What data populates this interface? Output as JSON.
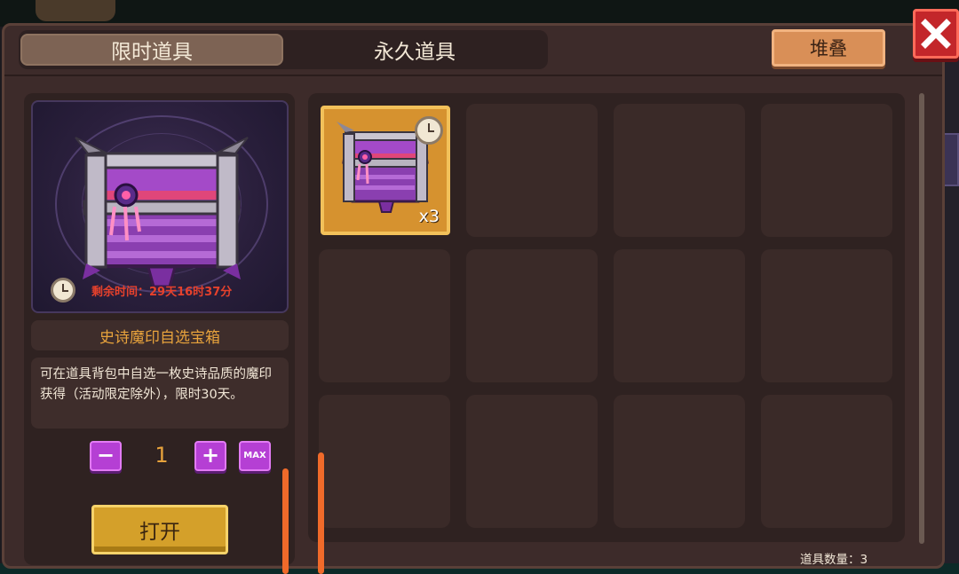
{
  "tabs": [
    {
      "label": "限时道具",
      "active": true
    },
    {
      "label": "永久道具",
      "active": false
    }
  ],
  "toolbar": {
    "stack_label": "堆叠"
  },
  "detail": {
    "time_remaining": "剩余时间：29天16时37分",
    "item_name": "史诗魔印自选宝箱",
    "description": "可在道具背包中自选一枚史诗品质的魔印获得（活动限定除外），限时30天。",
    "quantity": "1",
    "max_label": "MAX",
    "open_label": "打开"
  },
  "inventory": {
    "slots": [
      {
        "item": "epic-chest-icon",
        "count": "x3",
        "timed": true
      },
      {},
      {},
      {},
      {},
      {},
      {},
      {},
      {},
      {},
      {},
      {}
    ],
    "count_label": "道具数量：3"
  },
  "colors": {
    "panel": "#3d2b2a",
    "accent_orange": "#d98f57",
    "gold": "#e8a33c",
    "timer_red": "#e6412c",
    "purple_button": "#b53fd4"
  }
}
